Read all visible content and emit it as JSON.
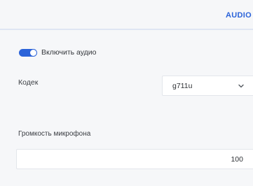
{
  "tabs": {
    "audio_label": "AUDIO"
  },
  "audio": {
    "enable_label": "Включить аудио",
    "enabled": true
  },
  "codec": {
    "label": "Кодек",
    "selected": "g711u"
  },
  "mic_volume": {
    "label": "Громкость микрофона",
    "value": "100"
  },
  "colors": {
    "accent": "#2b63d9",
    "background": "#f6f7f9",
    "field_bg": "#ffffff"
  },
  "icons": {
    "dropdown": "chevron-down-icon"
  }
}
